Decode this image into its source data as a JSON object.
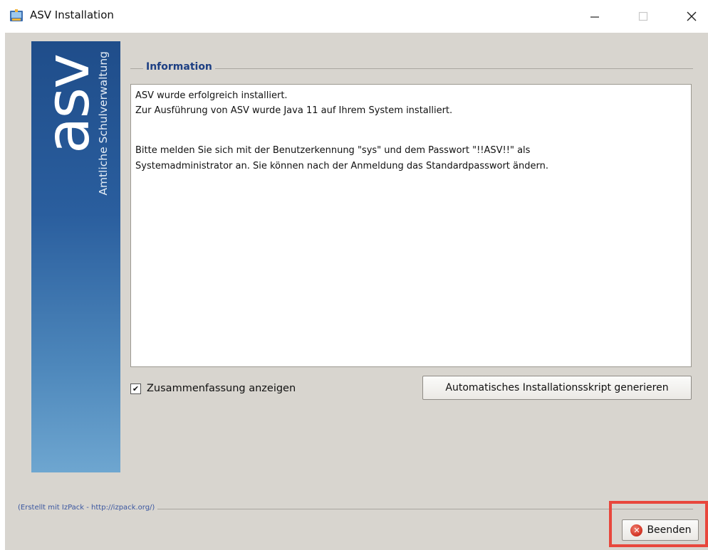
{
  "window": {
    "title": "ASV Installation",
    "icon": "installer-app-icon",
    "controls": {
      "minimize": "—",
      "maximize": "☐",
      "close": "✕"
    }
  },
  "banner": {
    "logo_text": "asv",
    "subtitle": "Amtliche Schulverwaltung",
    "colors": {
      "top": "#1f4d8a",
      "bottom": "#6ea6d0"
    }
  },
  "info": {
    "group_title": "Information",
    "lines": [
      "ASV wurde erfolgreich installiert.",
      "Zur Ausführung von ASV wurde Java 11 auf Ihrem System installiert.",
      "",
      "Bitte melden Sie sich mit der Benutzerkennung \"sys\" und dem Passwort \"!!ASV!!\" als",
      "Systemadministrator an. Sie können nach der Anmeldung das Standardpasswort ändern."
    ]
  },
  "options": {
    "show_summary_label": "Zusammenfassung anzeigen",
    "show_summary_checked": true,
    "checkmark": "✔",
    "generate_script_label": "Automatisches Installationsskript generieren"
  },
  "footer": {
    "credit": "(Erstellt mit IzPack - http://izpack.org/)",
    "quit_label": "Beenden",
    "quit_icon": "close-circle-icon",
    "highlight_color": "#e8473c"
  }
}
